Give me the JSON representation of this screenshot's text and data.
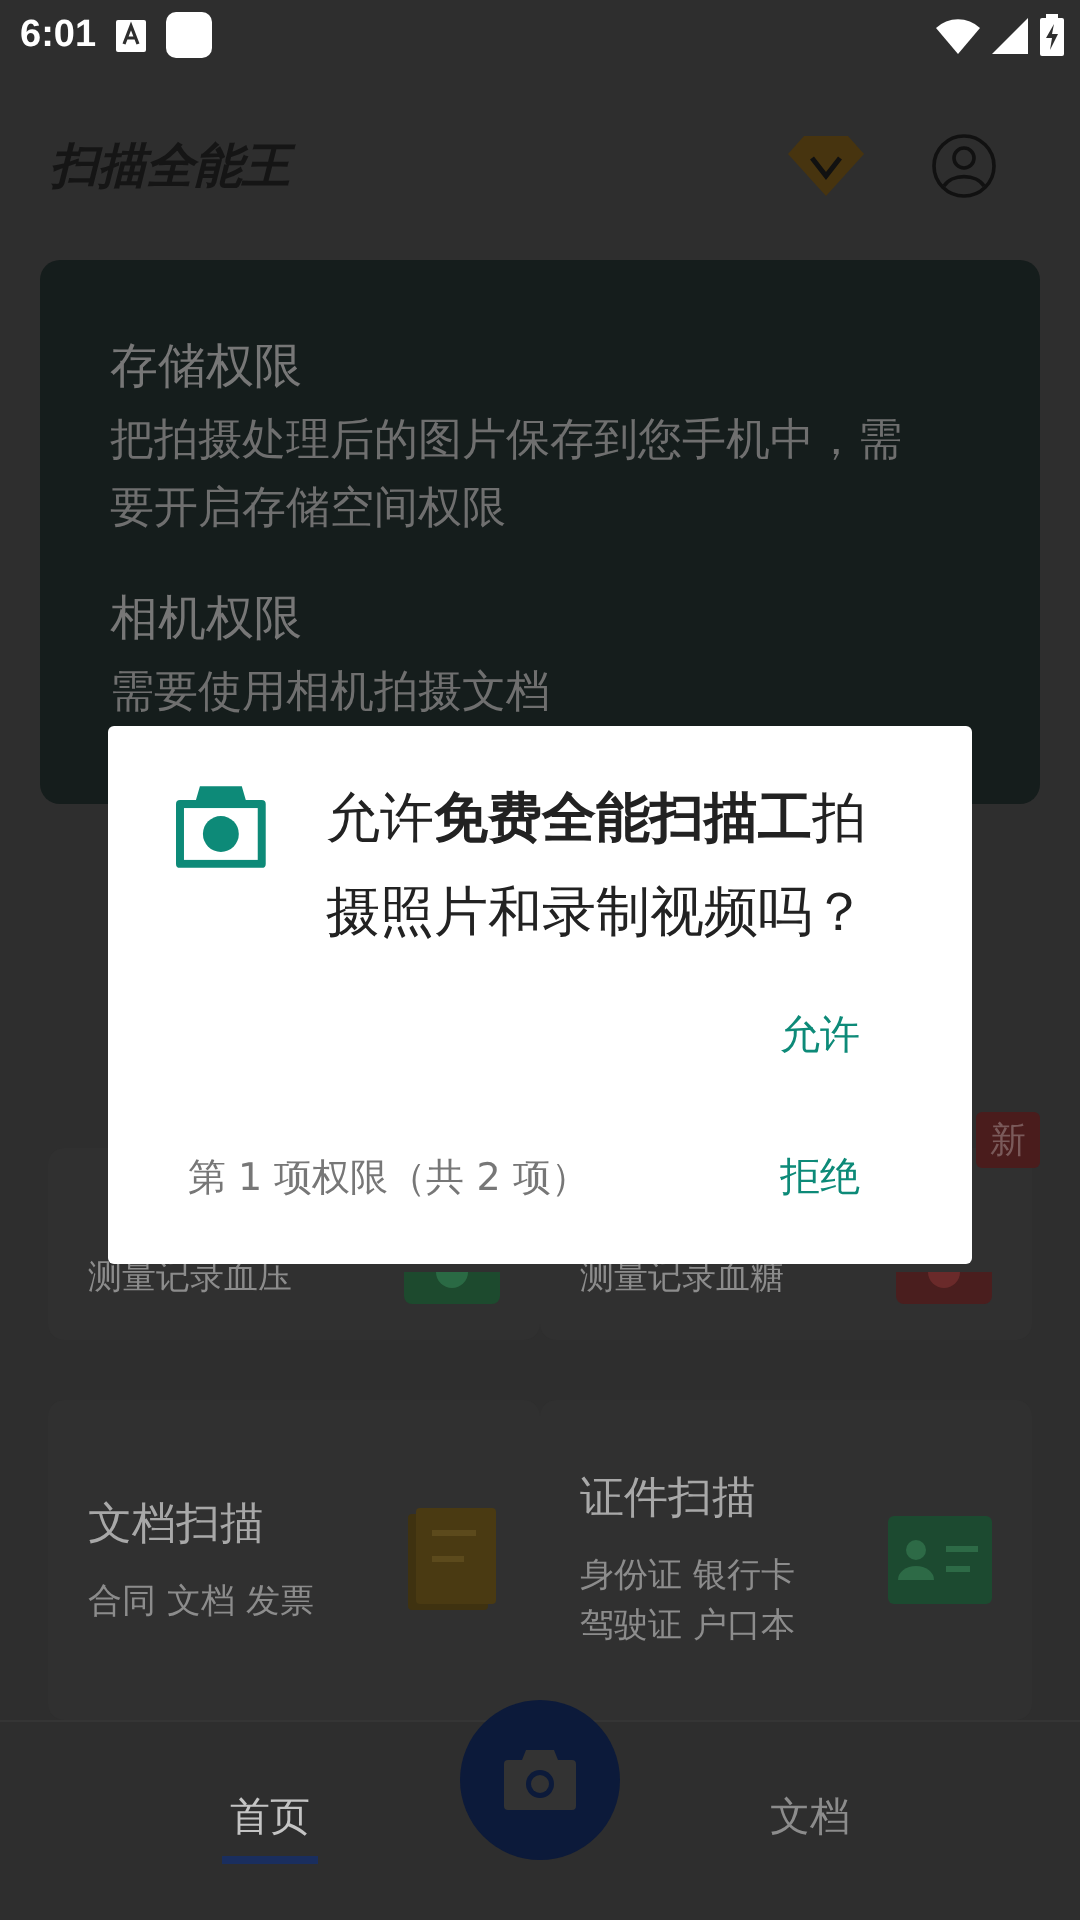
{
  "status_bar": {
    "time": "6:01"
  },
  "header": {
    "title": "扫描全能王"
  },
  "permission_card": {
    "sections": [
      {
        "title": "存储权限",
        "description": "把拍摄处理后的图片保存到您手机中，需要开启存储空间权限"
      },
      {
        "title": "相机权限",
        "description": "需要使用相机拍摄文档"
      }
    ]
  },
  "feature_cards": [
    {
      "subtitle": "测量记录血压"
    },
    {
      "subtitle": "测量记录血糖",
      "badge": "新"
    },
    {
      "title": "文档扫描",
      "subtitle": "合同 文档 发票"
    },
    {
      "title": "证件扫描",
      "subtitle": "身份证 银行卡",
      "subtitle_2": "驾驶证 户口本"
    }
  ],
  "bottom_nav": {
    "tabs": [
      {
        "label": "首页",
        "selected": true
      },
      {
        "label": "文档",
        "selected": false
      }
    ]
  },
  "dialog": {
    "message": "允许**免费全能扫描工**拍摄照片和录制视频吗？",
    "allow_button": "允许",
    "deny_button": "拒绝",
    "step": "第 1 项权限（共 2 项）"
  }
}
